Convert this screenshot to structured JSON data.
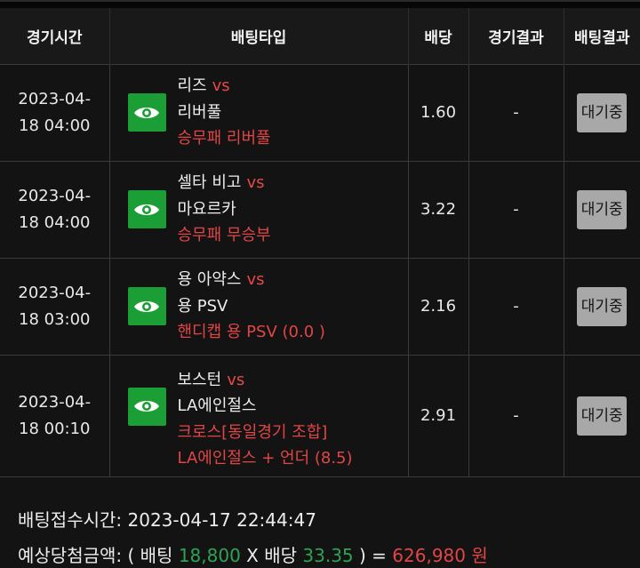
{
  "headers": {
    "time": "경기시간",
    "bet_type": "배팅타입",
    "odds": "배당",
    "game_result": "경기결과",
    "bet_result": "배팅결과"
  },
  "rows": [
    {
      "date": "2023-04-",
      "time": "18 04:00",
      "home": "리즈",
      "vs": "vs",
      "away": "리버풀",
      "picks": [
        "승무패 리버풀"
      ],
      "odds": "1.60",
      "result": "-",
      "status": "대기중"
    },
    {
      "date": "2023-04-",
      "time": "18 04:00",
      "home": "셀타 비고",
      "vs": "vs",
      "away": "마요르카",
      "picks": [
        "승무패 무승부"
      ],
      "odds": "3.22",
      "result": "-",
      "status": "대기중"
    },
    {
      "date": "2023-04-",
      "time": "18 03:00",
      "home": "용 아약스",
      "vs": "vs",
      "away": "용 PSV",
      "picks": [
        "핸디캡 용 PSV (0.0 )"
      ],
      "odds": "2.16",
      "result": "-",
      "status": "대기중"
    },
    {
      "date": "2023-04-",
      "time": "18 00:10",
      "home": "보스턴",
      "vs": "vs",
      "away": "LA에인절스",
      "picks": [
        "크로스[동일경기 조합]",
        "LA에인절스 + 언더 (8.5)"
      ],
      "odds": "2.91",
      "result": "-",
      "status": "대기중"
    }
  ],
  "footer": {
    "receipt_label": "배팅접수시간:",
    "receipt_time": "2023-04-17 22:44:47",
    "expected_label": "예상당첨금액: ( 배팅",
    "stake": "18,800",
    "times": "X 배당",
    "total_odds": "33.35",
    "close_eq": ") =",
    "payout": "626,980 원"
  },
  "colors": {
    "accent_green": "#1a9e35",
    "pick_red": "#e24545",
    "status_button": "#a8a8a8"
  },
  "icons": {
    "view": "eye-icon"
  }
}
